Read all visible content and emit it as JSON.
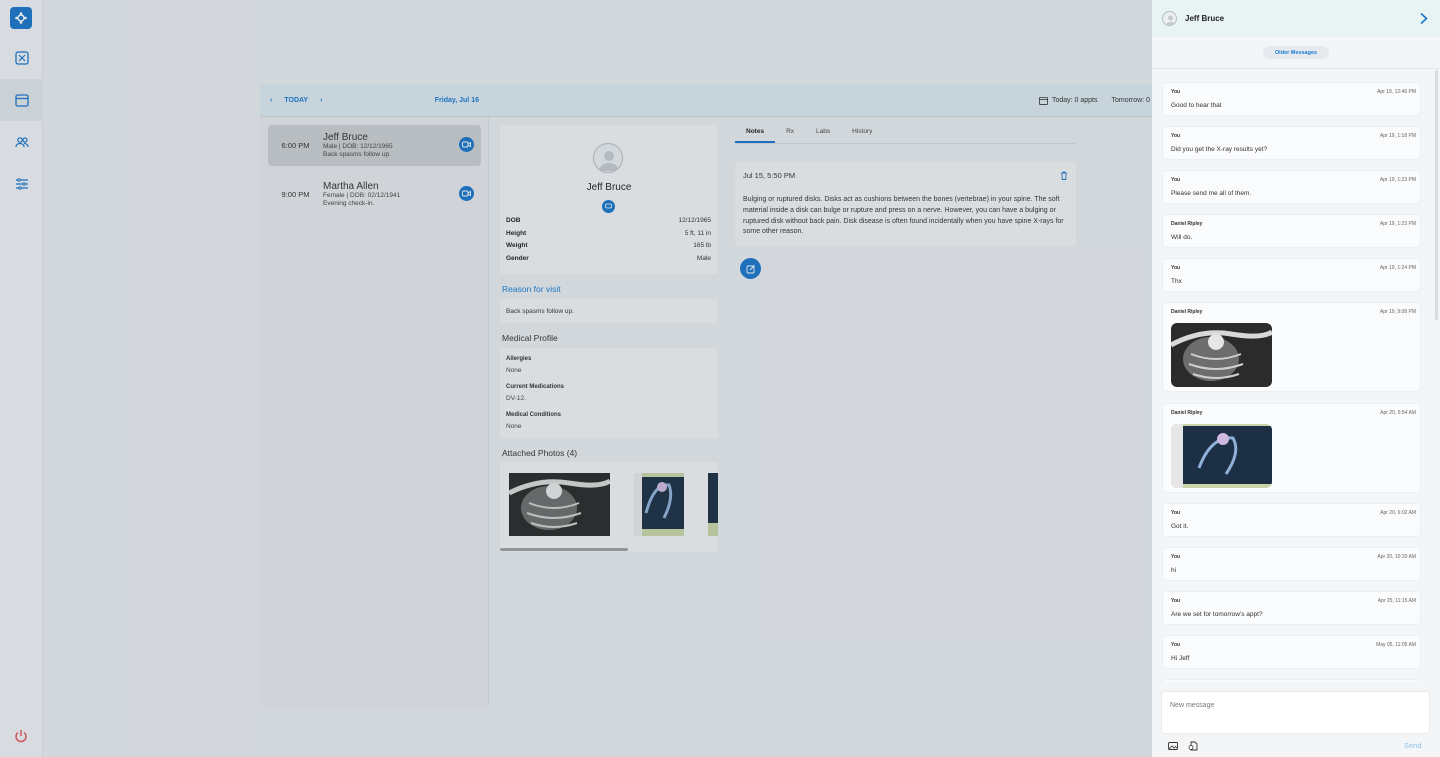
{
  "nav": {
    "items": [
      "logo-icon",
      "grid-icon",
      "calendar-icon",
      "users-icon",
      "sliders-icon"
    ],
    "power": "power-icon"
  },
  "schedule": {
    "prev": "‹",
    "today_label": "TODAY",
    "next": "›",
    "date": "Friday, Jul 16",
    "appointments": [
      {
        "time": "6:00 PM",
        "name": "Jeff Bruce",
        "meta": "Male | DOB: 12/12/1965",
        "note": "Back spasms follow up."
      },
      {
        "time": "9:00 PM",
        "name": "Martha Allen",
        "meta": "Female | DOB: 02/12/1941",
        "note": "Evening check-in."
      }
    ]
  },
  "header": {
    "today_appts": "Today: 0 appts",
    "tomorrow": "Tomorrow: 0"
  },
  "patient": {
    "name": "Jeff Bruce",
    "fields": [
      {
        "k": "DOB",
        "v": "12/12/1965"
      },
      {
        "k": "Height",
        "v": "5 ft, 11 in"
      },
      {
        "k": "Weight",
        "v": "165 lb"
      },
      {
        "k": "Gender",
        "v": "Male"
      }
    ],
    "reason_title": "Reason for visit",
    "reason": "Back spasms follow up.",
    "medical_title": "Medical Profile",
    "allergies_k": "Allergies",
    "allergies_v": "None",
    "meds_k": "Current Medications",
    "meds_v": "DV-12.",
    "conditions_k": "Medical Conditions",
    "conditions_v": "None",
    "photos_title": "Attached Photos (4)"
  },
  "notes": {
    "tabs": [
      "Notes",
      "Rx",
      "Labs",
      "History"
    ],
    "note_date": "Jul 15, 5:50 PM",
    "note_text": "Bulging or ruptured disks. Disks act as cushions between the bones (vertebrae) in your spine. The soft material inside a disk can bulge or rupture and press on a nerve. However, you can have a bulging or ruptured disk without back pain. Disk disease is often found incidentally when you have spine X-rays for some other reason."
  },
  "chat": {
    "name": "Jeff Bruce",
    "older": "Older Messages",
    "messages": [
      {
        "from": "You",
        "time": "Apr 19, 12:46 PM",
        "text": "Good to hear that"
      },
      {
        "from": "You",
        "time": "Apr 19, 1:18 PM",
        "text": "Did you get the X-ray results yet?"
      },
      {
        "from": "You",
        "time": "Apr 19, 1:23 PM",
        "text": "Please send me all of them."
      },
      {
        "from": "Daniel Ripley",
        "time": "Apr 19, 1:23 PM",
        "text": "Will do."
      },
      {
        "from": "You",
        "time": "Apr 19, 1:24 PM",
        "text": "Thx"
      },
      {
        "from": "Daniel Ripley",
        "time": "Apr 19, 9:08 PM",
        "text": ""
      },
      {
        "from": "Daniel Ripley",
        "time": "Apr 20, 5:54 AM",
        "text": ""
      },
      {
        "from": "You",
        "time": "Apr 20, 6:02 AM",
        "text": "Got it."
      },
      {
        "from": "You",
        "time": "Apr 20, 10:20 AM",
        "text": "hi"
      },
      {
        "from": "You",
        "time": "Apr 25, 11:15 AM",
        "text": "Are we set for tomorrow's appt?"
      },
      {
        "from": "You",
        "time": "May 05, 11:05 AM",
        "text": "Hi Jeff"
      }
    ],
    "placeholder": "New message",
    "send": "Send"
  }
}
